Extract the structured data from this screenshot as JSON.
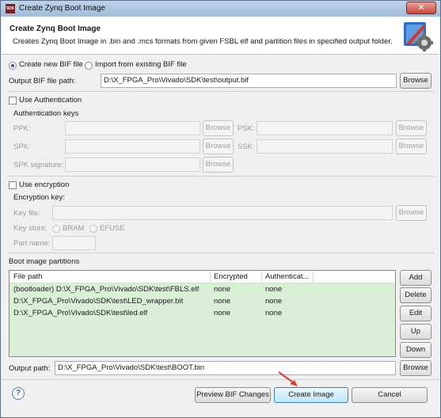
{
  "window": {
    "title": "Create Zynq Boot Image",
    "app_icon_text": "SDK",
    "close_label": "✕"
  },
  "header": {
    "title": "Create Zynq Boot Image",
    "description": "Creates Zynq Boot Image in .bin and .mcs formats from given FSBL elf and partition files in specified output folder."
  },
  "bif": {
    "create_new_label": "Create new BIF file",
    "create_new_selected": true,
    "import_label": "Import from existing BIF file",
    "output_label": "Output BIF file path:",
    "output_value": "D:\\X_FPGA_Pro\\Vivado\\SDK\\test\\output.bif",
    "browse_label": "Browse"
  },
  "authentication": {
    "checkbox_label": "Use Authentication",
    "group_label": "Authentication keys",
    "ppk_label": "PPK:",
    "psk_label": "PSK:",
    "spk_label": "SPK:",
    "ssk_label": "SSK:",
    "spk_signature_label": "SPK signature:",
    "browse_label": "Browse"
  },
  "encryption": {
    "checkbox_label": "Use encryption",
    "group_label": "Encryption key:",
    "key_file_label": "Key file:",
    "browse_label": "Browse",
    "key_store_label": "Key store:",
    "bram_label": "BRAM",
    "efuse_label": "EFUSE",
    "part_name_label": "Part name:"
  },
  "partitions": {
    "section_label": "Boot image partitions",
    "columns": [
      "File path",
      "Encrypted",
      "Authenticat..."
    ],
    "rows": [
      {
        "path": "(bootloader) D:\\X_FPGA_Pro\\Vivado\\SDK\\test\\FBLS.elf",
        "encrypted": "none",
        "authenticated": "none"
      },
      {
        "path": "D:\\X_FPGA_Pro\\Vivado\\SDK\\test\\LED_wrapper.bit",
        "encrypted": "none",
        "authenticated": "none"
      },
      {
        "path": "D:\\X_FPGA_Pro\\Vivado\\SDK\\test\\led.elf",
        "encrypted": "none",
        "authenticated": "none"
      }
    ],
    "add_label": "Add",
    "delete_label": "Delete",
    "edit_label": "Edit",
    "up_label": "Up",
    "down_label": "Down"
  },
  "output": {
    "label": "Output path:",
    "value": "D:\\X_FPGA_Pro\\Vivado\\SDK\\test\\BOOT.bin",
    "browse_label": "Browse"
  },
  "footer": {
    "help_label": "?",
    "preview_label": "Preview BIF Changes",
    "create_label": "Create Image",
    "cancel_label": "Cancel"
  },
  "colors": {
    "table_rows_bg": "#d9f0d6",
    "annotation_arrow": "#e23a2e",
    "title_gradient_top": "#bfd4ea"
  }
}
